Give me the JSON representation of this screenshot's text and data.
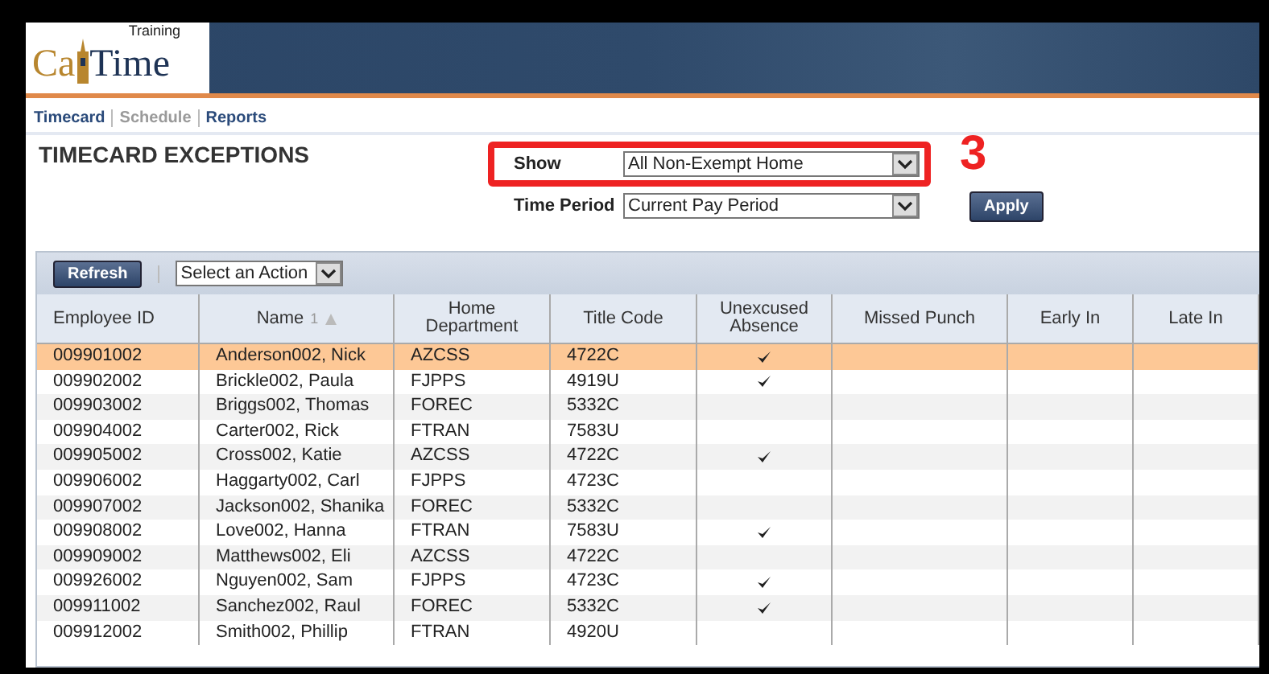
{
  "logo": {
    "tagline": "Training",
    "prefix": "Ca",
    "suffix": "Time"
  },
  "nav": [
    {
      "label": "Timecard",
      "disabled": false
    },
    {
      "label": "Schedule",
      "disabled": true
    },
    {
      "label": "Reports",
      "disabled": false
    }
  ],
  "page_title": "TIMECARD EXCEPTIONS",
  "filters": [
    {
      "label": "Show",
      "value": "All Non-Exempt Home",
      "highlighted": true
    },
    {
      "label": "Time Period",
      "value": "Current Pay Period",
      "highlighted": false
    }
  ],
  "annotation": "3",
  "apply_button": "Apply",
  "toolbar": {
    "refresh_button": "Refresh",
    "action_select": "Select an Action"
  },
  "table": {
    "columns": [
      {
        "label": "Employee ID"
      },
      {
        "label": "Name",
        "sort_order": "1"
      },
      {
        "label": "Home Department"
      },
      {
        "label": "Title Code"
      },
      {
        "label": "Unexcused Absence"
      },
      {
        "label": "Missed Punch"
      },
      {
        "label": "Early In"
      },
      {
        "label": "Late In"
      }
    ],
    "rows": [
      {
        "id": "009901002",
        "name": "Anderson002, Nick",
        "dept": "AZCSS",
        "title": "4722C",
        "unexcused": true,
        "selected": true
      },
      {
        "id": "009902002",
        "name": "Brickle002, Paula",
        "dept": "FJPPS",
        "title": "4919U",
        "unexcused": true,
        "selected": false
      },
      {
        "id": "009903002",
        "name": "Briggs002, Thomas",
        "dept": "FOREC",
        "title": "5332C",
        "unexcused": false,
        "selected": false
      },
      {
        "id": "009904002",
        "name": "Carter002, Rick",
        "dept": "FTRAN",
        "title": "7583U",
        "unexcused": false,
        "selected": false
      },
      {
        "id": "009905002",
        "name": "Cross002, Katie",
        "dept": "AZCSS",
        "title": "4722C",
        "unexcused": true,
        "selected": false
      },
      {
        "id": "009906002",
        "name": "Haggarty002, Carl",
        "dept": "FJPPS",
        "title": "4723C",
        "unexcused": false,
        "selected": false
      },
      {
        "id": "009907002",
        "name": "Jackson002, Shanika",
        "dept": "FOREC",
        "title": "5332C",
        "unexcused": false,
        "selected": false
      },
      {
        "id": "009908002",
        "name": "Love002, Hanna",
        "dept": "FTRAN",
        "title": "7583U",
        "unexcused": true,
        "selected": false
      },
      {
        "id": "009909002",
        "name": "Matthews002, Eli",
        "dept": "AZCSS",
        "title": "4722C",
        "unexcused": false,
        "selected": false
      },
      {
        "id": "009926002",
        "name": "Nguyen002, Sam",
        "dept": "FJPPS",
        "title": "4723C",
        "unexcused": true,
        "selected": false
      },
      {
        "id": "009911002",
        "name": "Sanchez002, Raul",
        "dept": "FOREC",
        "title": "5332C",
        "unexcused": true,
        "selected": false
      },
      {
        "id": "009912002",
        "name": "Smith002, Phillip",
        "dept": "FTRAN",
        "title": "4920U",
        "unexcused": false,
        "selected": false
      }
    ]
  }
}
